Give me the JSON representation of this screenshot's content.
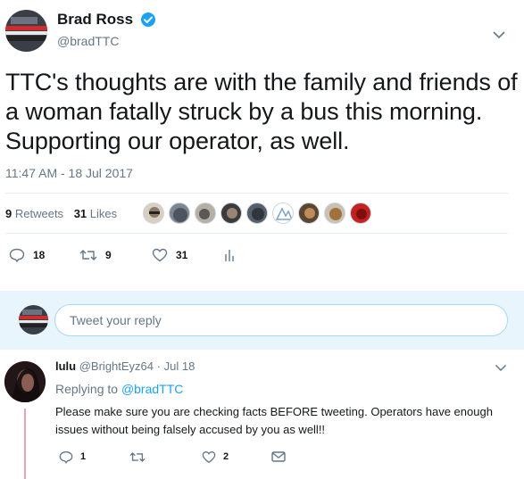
{
  "tweet": {
    "author_name": "Brad Ross",
    "author_handle": "@bradTTC",
    "verified": true,
    "text": "TTC's thoughts are with the family and friends of a woman fatally struck by a bus this morning. Supporting our operator, as well.",
    "timestamp": "11:47 AM - 18 Jul 2017",
    "stats": {
      "retweets_count": "9",
      "retweets_label": "Retweets",
      "likes_count": "31",
      "likes_label": "Likes"
    },
    "liker_avatars": [
      "liker-avatar-1",
      "liker-avatar-2",
      "liker-avatar-3",
      "liker-avatar-4",
      "liker-avatar-5",
      "liker-avatar-6",
      "liker-avatar-7",
      "liker-avatar-8",
      "liker-avatar-9"
    ],
    "actions": {
      "reply_count": "18",
      "retweet_count": "9",
      "like_count": "31"
    }
  },
  "reply_box": {
    "placeholder": "Tweet your reply"
  },
  "reply": {
    "author_name": "lulu",
    "author_handle": "@BrightEyz64",
    "separator": "·",
    "date": "Jul 18",
    "replying_to_label": "Replying to",
    "replying_to_handle": "@bradTTC",
    "text": "Please make sure you are checking facts BEFORE tweeting. Operators have enough issues without being falsely accused by you as well!!",
    "actions": {
      "reply_count": "1",
      "like_count": "2"
    }
  },
  "colors": {
    "accent": "#1da1f2",
    "secondary_text": "#657786",
    "reply_bar_bg": "#e8f5fd",
    "divider": "#e6ecf0"
  }
}
